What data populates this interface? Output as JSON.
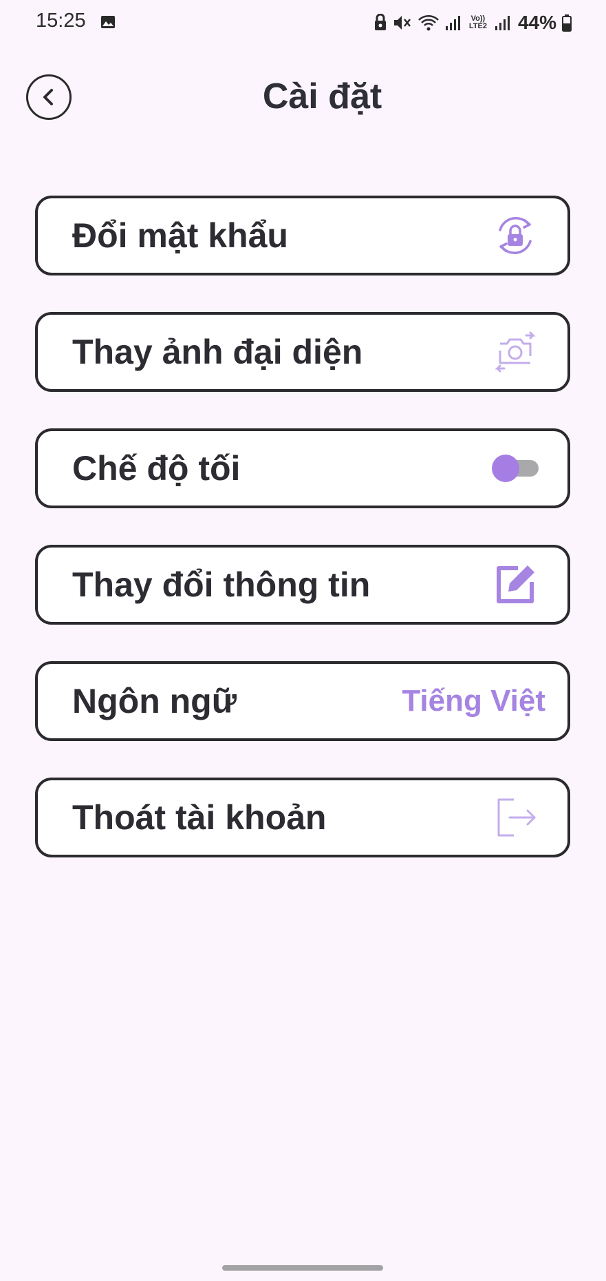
{
  "status_bar": {
    "time": "15:25",
    "battery": "44%",
    "network_label": "Vo)) LTE2",
    "icons": [
      "gallery-icon",
      "lock-icon",
      "mute-icon",
      "wifi-icon",
      "signal-icon",
      "battery-icon"
    ]
  },
  "header": {
    "title": "Cài đặt",
    "back_icon": "chevron-left-icon"
  },
  "settings": {
    "items": [
      {
        "label": "Đổi mật khẩu",
        "icon": "lock-refresh-icon"
      },
      {
        "label": "Thay ảnh đại diện",
        "icon": "camera-switch-icon"
      },
      {
        "label": "Chế độ tối",
        "toggle_on": false
      },
      {
        "label": "Thay đổi thông tin",
        "icon": "edit-icon"
      },
      {
        "label": "Ngôn ngữ",
        "value": "Tiếng Việt"
      },
      {
        "label": "Thoát tài khoản",
        "icon": "logout-icon"
      }
    ]
  },
  "colors": {
    "accent": "#a684e2",
    "background": "#fcf5fd",
    "border": "#2b2b2f"
  }
}
